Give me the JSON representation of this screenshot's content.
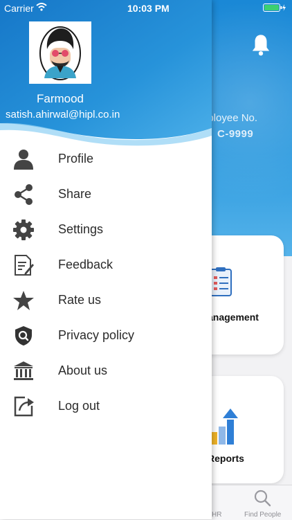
{
  "status_bar": {
    "carrier": "Carrier",
    "time": "10:03 PM"
  },
  "background": {
    "employee_label": "nployee No.",
    "employee_no": "C-9999",
    "card1_title": "anagement",
    "card2_title": "Reports",
    "tabs": [
      {
        "label": "HR"
      },
      {
        "label": "Find People"
      }
    ]
  },
  "drawer": {
    "name": "Farmood",
    "email": "satish.ahirwal@hipl.co.in",
    "menu": [
      {
        "label": "Profile",
        "icon": "person-icon"
      },
      {
        "label": "Share",
        "icon": "share-icon"
      },
      {
        "label": "Settings",
        "icon": "gear-icon"
      },
      {
        "label": "Feedback",
        "icon": "feedback-icon"
      },
      {
        "label": "Rate us",
        "icon": "star-icon"
      },
      {
        "label": "Privacy policy",
        "icon": "shield-icon"
      },
      {
        "label": "About us",
        "icon": "bank-icon"
      },
      {
        "label": "Log out",
        "icon": "logout-icon"
      }
    ]
  },
  "colors": {
    "header_blue": "#1a88d6",
    "icon_gray": "#444444"
  }
}
